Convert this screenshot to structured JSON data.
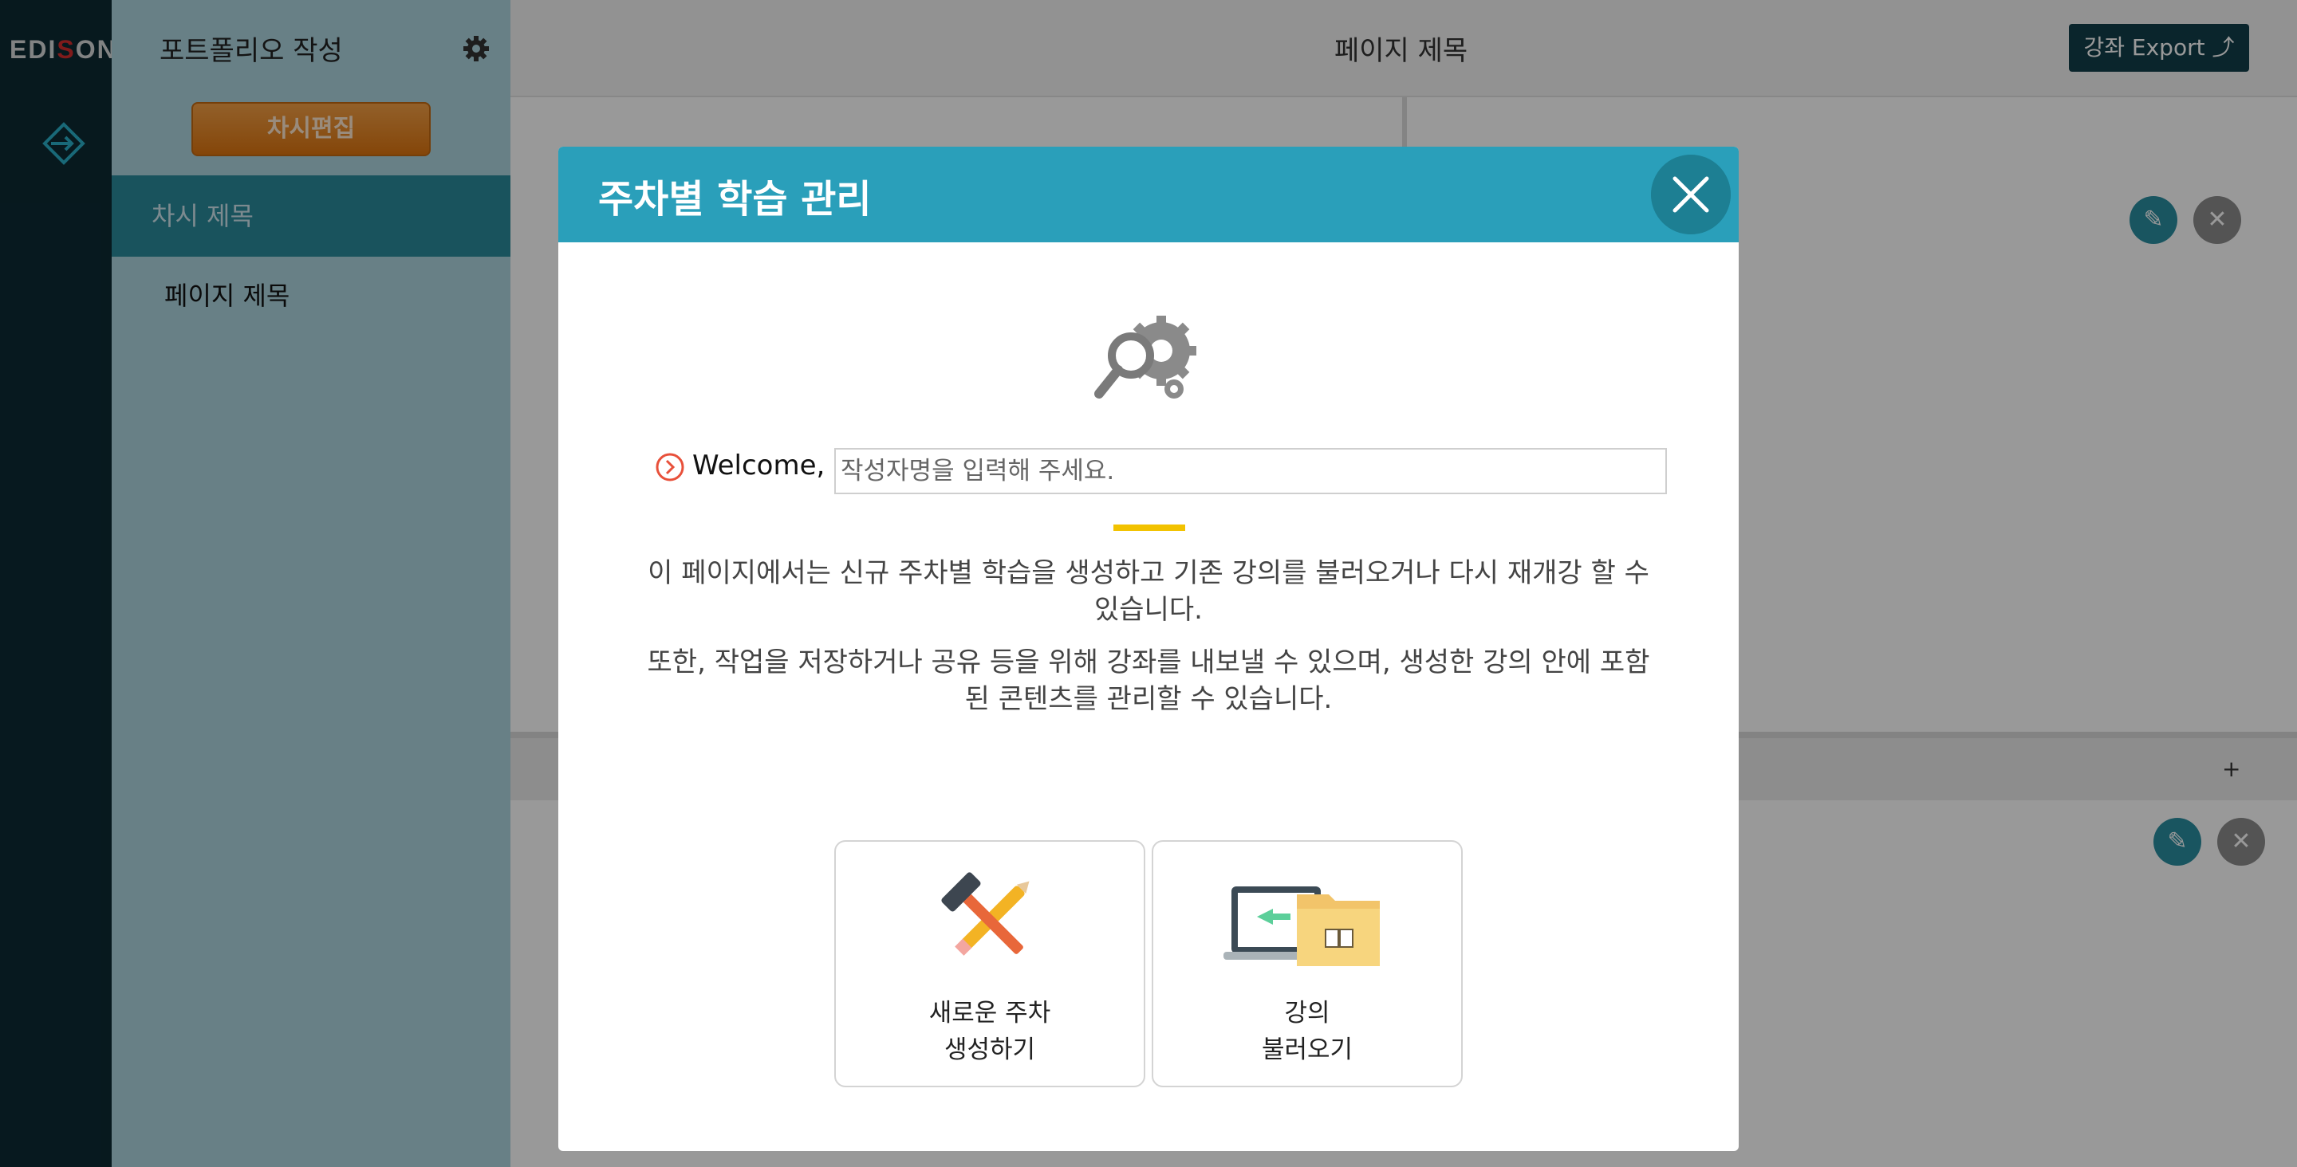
{
  "app": {
    "logo_text": "EDISON"
  },
  "sidebar": {
    "title": "포트폴리오 작성",
    "edit_button": "차시편집",
    "lesson_title": "차시 제목",
    "page_item": "페이지 제목"
  },
  "header": {
    "page_title": "페이지 제목",
    "export_label": "강좌 Export ⤴"
  },
  "content": {
    "add_label": "+"
  },
  "modal": {
    "title": "주차별 학습 관리",
    "welcome_label": "Welcome,",
    "author_placeholder": "작성자명을 입력해 주세요.",
    "author_value": "",
    "description_1": "이 페이지에서는 신규 주차별 학습을 생성하고 기존 강의를 불러오거나 다시 재개강 할 수 있습니다.",
    "description_2": "또한, 작업을 저장하거나 공유 등을 위해 강좌를 내보낼 수 있으며, 생성한 강의 안에 포함된 콘텐츠를 관리할 수 있습니다.",
    "cards": [
      {
        "line1": "새로운 주차",
        "line2": "생성하기",
        "icon": "hammer-pencil-icon"
      },
      {
        "line1": "강의",
        "line2": "불러오기",
        "icon": "laptop-folder-icon"
      }
    ]
  },
  "colors": {
    "rail": "#0c2a33",
    "sidebar": "#aed5df",
    "sidebar_active": "#2a8a9c",
    "modal_header": "#2a9fba",
    "edit_button": "#e8861e",
    "accent_yellow": "#f2c200",
    "export_button": "#123f4a"
  }
}
